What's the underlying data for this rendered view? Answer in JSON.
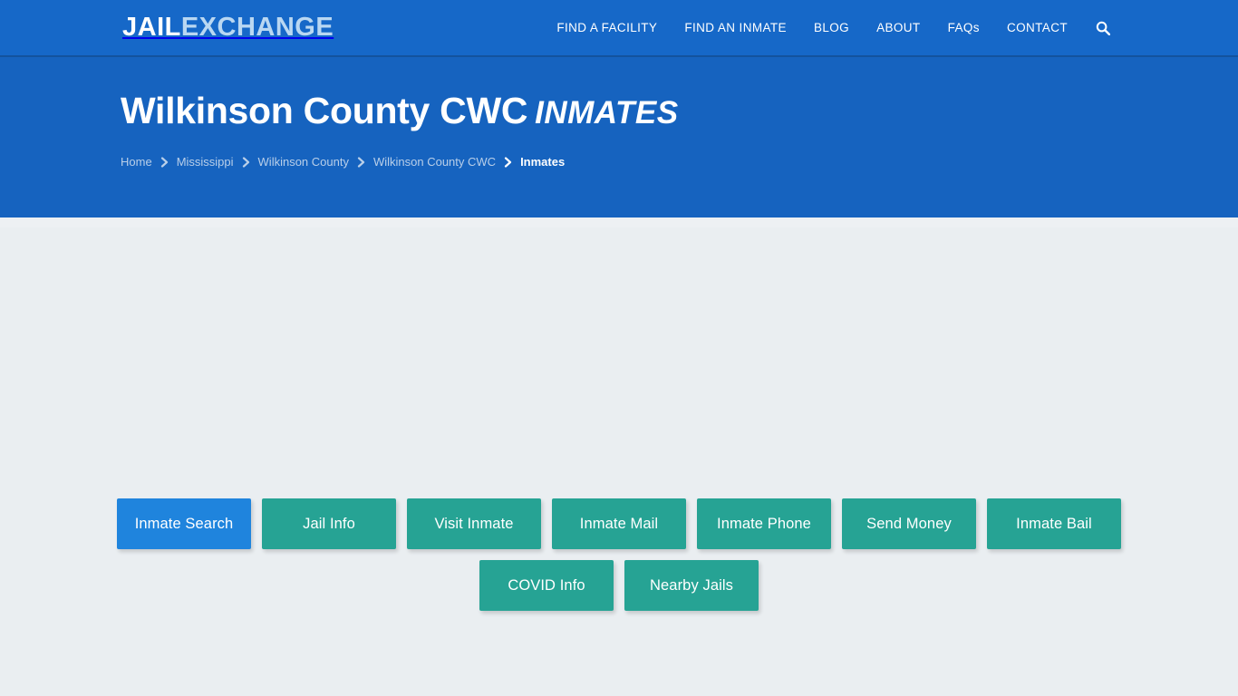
{
  "site": {
    "brand_primary": "JAIL",
    "brand_secondary": "EXCHANGE",
    "colors": {
      "nav_blue": "#1668c8",
      "hero_blue": "#1663bf",
      "content_bg": "#eaeef1",
      "button_teal": "#26a394",
      "button_active_blue": "#1f84dd",
      "breadcrumb_link": "#b9cfe9"
    }
  },
  "nav": {
    "items": [
      {
        "label": "FIND A FACILITY"
      },
      {
        "label": "FIND AN INMATE"
      },
      {
        "label": "BLOG"
      },
      {
        "label": "ABOUT"
      },
      {
        "label": "FAQs"
      },
      {
        "label": "CONTACT"
      }
    ],
    "search_icon": "search-icon"
  },
  "hero": {
    "title": "Wilkinson County CWC",
    "title_suffix": "INMATES",
    "breadcrumb": [
      {
        "label": "Home",
        "current": false
      },
      {
        "label": "Mississippi",
        "current": false
      },
      {
        "label": "Wilkinson County",
        "current": false
      },
      {
        "label": "Wilkinson County CWC",
        "current": false
      },
      {
        "label": "Inmates",
        "current": true
      }
    ]
  },
  "main": {
    "buttons_row1": [
      {
        "label": "Inmate Search",
        "active": true
      },
      {
        "label": "Jail Info",
        "active": false
      },
      {
        "label": "Visit Inmate",
        "active": false
      },
      {
        "label": "Inmate Mail",
        "active": false
      },
      {
        "label": "Inmate Phone",
        "active": false
      },
      {
        "label": "Send Money",
        "active": false
      },
      {
        "label": "Inmate Bail",
        "active": false
      }
    ],
    "buttons_row2": [
      {
        "label": "COVID Info",
        "active": false
      },
      {
        "label": "Nearby Jails",
        "active": false
      }
    ]
  }
}
